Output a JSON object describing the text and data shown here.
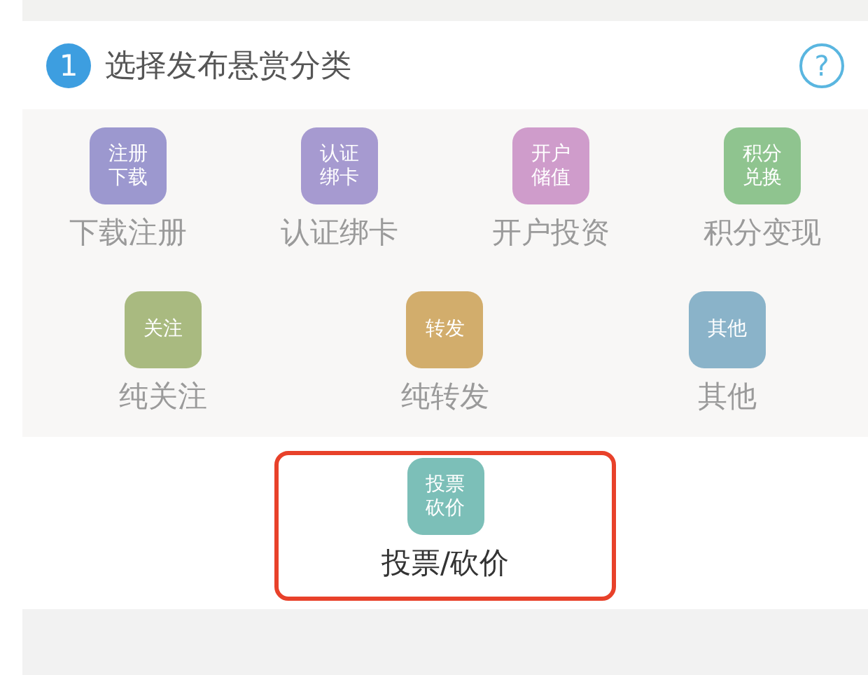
{
  "header": {
    "step": "1",
    "title": "选择发布悬赏分类",
    "help": "?"
  },
  "rows": [
    {
      "items": [
        {
          "tile": [
            "注册",
            "下载"
          ],
          "label": "下载注册",
          "color": "#9c98cf",
          "selected": false
        },
        {
          "tile": [
            "认证",
            "绑卡"
          ],
          "label": "认证绑卡",
          "color": "#a69ad0",
          "selected": false
        },
        {
          "tile": [
            "开户",
            "储值"
          ],
          "label": "开户投资",
          "color": "#cf9ccb",
          "selected": false
        },
        {
          "tile": [
            "积分",
            "兑换"
          ],
          "label": "积分变现",
          "color": "#8fc48f",
          "selected": false
        }
      ]
    },
    {
      "items": [
        {
          "tile": [
            "关注"
          ],
          "label": "纯关注",
          "color": "#a9ba80",
          "selected": false
        },
        {
          "tile": [
            "转发"
          ],
          "label": "纯转发",
          "color": "#d2ad6c",
          "selected": false
        },
        {
          "tile": [
            "其他"
          ],
          "label": "其他",
          "color": "#8ab3c9",
          "selected": false
        }
      ]
    },
    {
      "items": [
        {
          "tile": [
            "投票",
            "砍价"
          ],
          "label": "投票/砍价",
          "color": "#7cbfb8",
          "selected": true
        }
      ]
    }
  ]
}
